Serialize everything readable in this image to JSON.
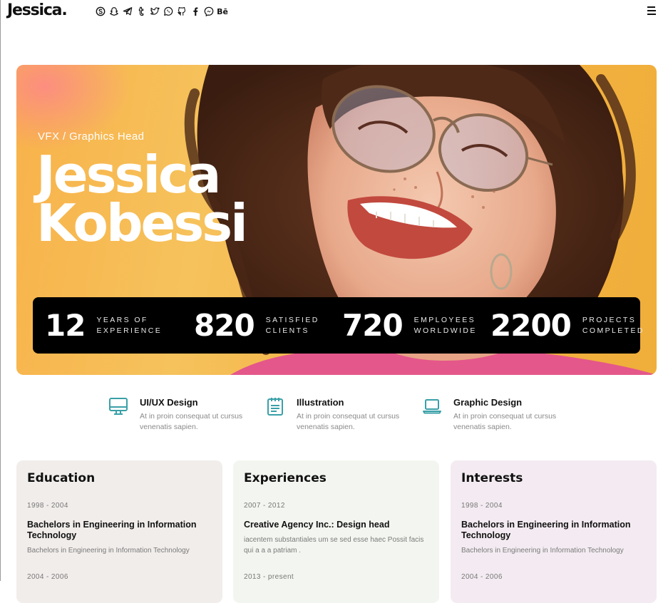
{
  "brand": {
    "logo": "Jessica."
  },
  "social_icons": [
    "skype-icon",
    "snapchat-icon",
    "telegram-icon",
    "tumblr-icon",
    "twitter-icon",
    "whatsapp-icon",
    "github-icon",
    "facebook-icon",
    "messenger-icon",
    "behance-icon"
  ],
  "social_behance_text": "Bē",
  "hero": {
    "role": "VFX / Graphics Head",
    "first_name": "Jessica",
    "last_name": "Kobessi",
    "stats": [
      {
        "number": "12",
        "line1": "YEARS OF",
        "line2": "EXPERIENCE"
      },
      {
        "number": "820",
        "line1": "SATISFIED",
        "line2": "CLIENTS"
      },
      {
        "number": "720",
        "line1": "EMPLOYEES",
        "line2": "WORLDWIDE"
      },
      {
        "number": "2200",
        "line1": "PROJECTS",
        "line2": "COMPLETED"
      }
    ]
  },
  "services": [
    {
      "title": "UI/UX Design",
      "desc": "At in proin consequat ut cursus venenatis sapien.",
      "icon": "monitor-icon"
    },
    {
      "title": "Illustration",
      "desc": "At in proin consequat ut cursus venenatis sapien.",
      "icon": "notepad-icon"
    },
    {
      "title": "Graphic Design",
      "desc": "At in proin consequat ut cursus venenatis sapien.",
      "icon": "laptop-icon"
    }
  ],
  "cards": {
    "education": {
      "title": "Education",
      "entries": [
        {
          "date": "1998 - 2004",
          "title": "Bachelors in Engineering in Information Technology",
          "desc": "Bachelors in Engineering in Information Technology"
        },
        {
          "date": "2004 - 2006"
        }
      ]
    },
    "experiences": {
      "title": "Experiences",
      "entries": [
        {
          "date": "2007 - 2012",
          "title": "Creative Agency Inc.: Design head",
          "desc": "iacentem substantiales um se sed esse haec Possit facis qui a a a patriam ."
        },
        {
          "date": "2013 - present"
        }
      ]
    },
    "interests": {
      "title": "Interests",
      "entries": [
        {
          "date": "1998 - 2004",
          "title": "Bachelors in Engineering in Information Technology",
          "desc": "Bachelors in Engineering in Information Technology"
        },
        {
          "date": "2004 - 2006"
        }
      ]
    }
  },
  "colors": {
    "accent": "#3aa0a8",
    "hero_bg": "#f6b84a",
    "stats_bg": "#000000",
    "card_education": "#f1edeb",
    "card_experiences": "#f3f6f0",
    "card_interests": "#f3ebf1"
  }
}
